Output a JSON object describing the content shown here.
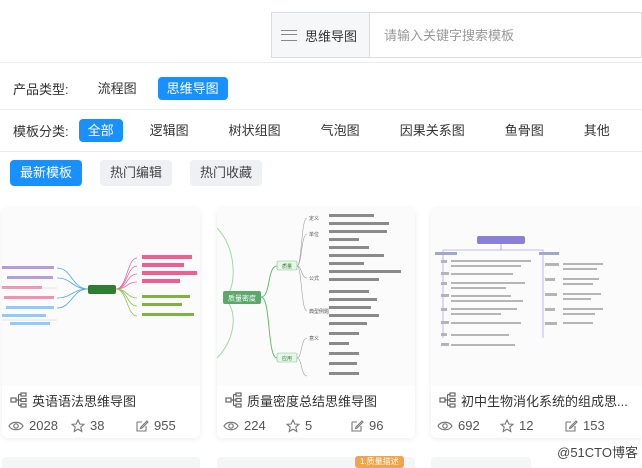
{
  "search": {
    "category": "思维导图",
    "placeholder": "请输入关键字搜索模板"
  },
  "product_type": {
    "label": "产品类型:",
    "options": [
      "流程图",
      "思维导图"
    ],
    "active": "思维导图"
  },
  "template_category": {
    "label": "模板分类:",
    "options": [
      "全部",
      "逻辑图",
      "树状组图",
      "气泡图",
      "因果关系图",
      "鱼骨图",
      "其他"
    ],
    "active": "全部"
  },
  "sort_tabs": {
    "options": [
      "最新模板",
      "热门编辑",
      "热门收藏"
    ],
    "active": "最新模板"
  },
  "cards": [
    {
      "title": "英语语法思维导图",
      "views": "2028",
      "likes": "38",
      "edits": "955"
    },
    {
      "title": "质量密度总结思维导图",
      "views": "224",
      "likes": "5",
      "edits": "96",
      "thumb_center": "质量密度",
      "thumb_nodes": [
        "定义",
        "单位",
        "公式",
        "典型例题",
        "质量",
        "应用",
        "意义"
      ]
    },
    {
      "title": "初中生物消化系统的组成思...",
      "views": "692",
      "likes": "12",
      "edits": "153"
    }
  ],
  "bottom_badge": "1.质量描述",
  "watermark": "@51CTO博客",
  "colors": {
    "accent": "#1890ff",
    "green": "#4caf50",
    "purple": "#7b6fd6"
  },
  "icons": {
    "menu": "hamburger-icon",
    "mindmap": "mindmap-icon",
    "views": "eye-icon",
    "likes": "star-icon",
    "edits": "edit-icon"
  }
}
